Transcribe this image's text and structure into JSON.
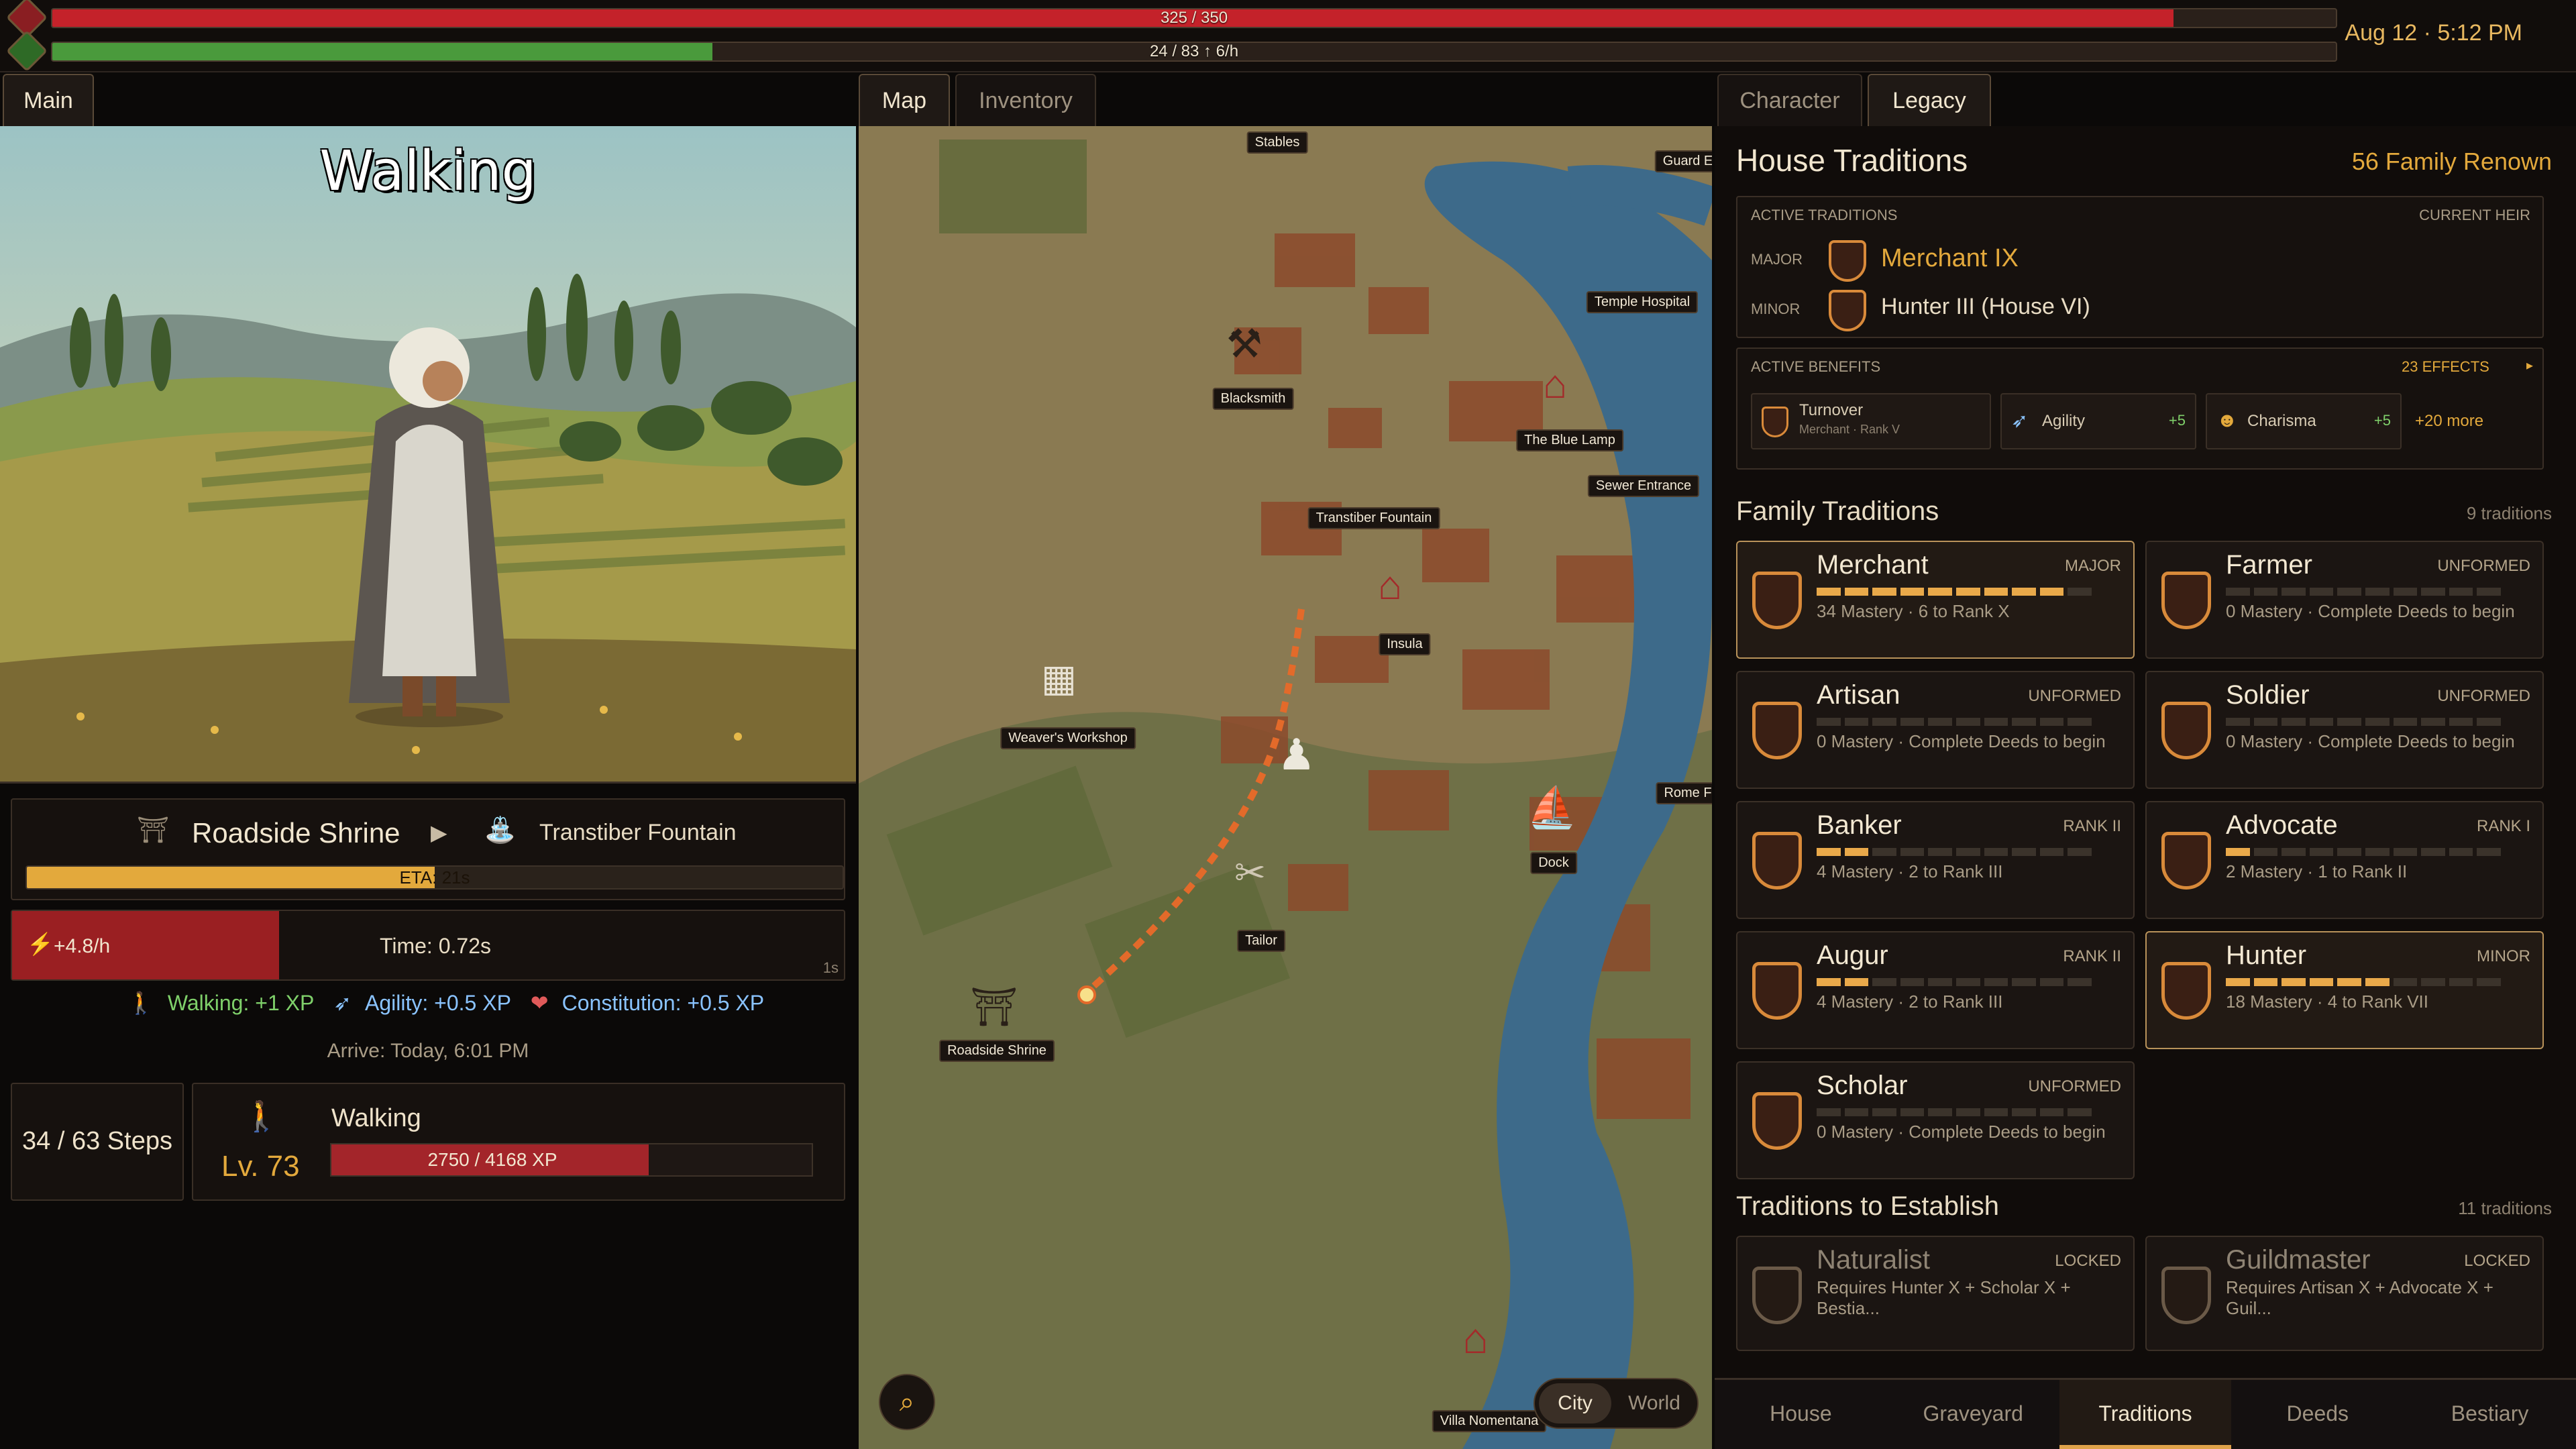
{
  "top": {
    "health_text": "325 / 350",
    "health_pct": 0.929,
    "energy_text": "24 / 83 ↑ 6/h",
    "energy_pct": 0.289,
    "clock": "Aug 12 · 5:12 PM",
    "colors": {
      "health": "#c4222a",
      "energy": "#4a9a3c"
    }
  },
  "left": {
    "tab_main": "Main",
    "scene_title": "Walking",
    "route": {
      "from": "Roadside Shrine",
      "to": "Transtiber Fountain",
      "eta": "ETA: 21s",
      "progress_pct": 0.5
    },
    "rate": "+4.8/h",
    "time": "Time: 0.72s",
    "interval": "1s",
    "xp": {
      "walking": "Walking: +1 XP",
      "agility": "Agility: +0.5 XP",
      "constitution": "Constitution: +0.5 XP"
    },
    "arrive": "Arrive: Today, 6:01 PM",
    "steps": "34 / 63 Steps",
    "skill": {
      "name": "Walking",
      "level": "Lv. 73",
      "xp_text": "2750 / 4168 XP",
      "xp_pct": 0.66
    }
  },
  "map": {
    "tabs": [
      "Map",
      "Inventory"
    ],
    "labels": {
      "stables": "Stables",
      "guard": "Guard E",
      "temple_hospital": "Temple Hospital",
      "blacksmith": "Blacksmith",
      "blue_lamp": "The Blue Lamp",
      "sewer_entrance": "Sewer Entrance",
      "transtiber_fountain": "Transtiber Fountain",
      "insula": "Insula",
      "weavers_workshop": "Weaver's Workshop",
      "rome": "Rome F",
      "dock": "Dock",
      "tailor": "Tailor",
      "roadside_shrine": "Roadside Shrine",
      "villa_nomentana": "Villa Nomentana"
    },
    "toggle": {
      "city": "City",
      "world": "World"
    }
  },
  "right": {
    "tabs": [
      "Character",
      "Legacy"
    ],
    "title": "House Traditions",
    "renown": "56 Family Renown",
    "active_traditions": {
      "heading": "ACTIVE TRADITIONS",
      "current_heir": "CURRENT HEIR",
      "major_label": "MAJOR",
      "major": "Merchant IX",
      "minor_label": "MINOR",
      "minor": "Hunter III (House VI)"
    },
    "active_benefits": {
      "heading": "ACTIVE BENEFITS",
      "effects": "23 EFFECTS",
      "turnover": "Turnover",
      "turnover_sub": "Merchant · Rank V",
      "agility": "Agility",
      "agility_val": "+5",
      "charisma": "Charisma",
      "charisma_val": "+5",
      "more": "+20 more"
    },
    "family": {
      "heading": "Family Traditions",
      "count": "9 traditions",
      "cards": [
        {
          "name": "Merchant",
          "tag": "MAJOR",
          "desc": "34 Mastery · 6 to Rank X",
          "filled": 9
        },
        {
          "name": "Farmer",
          "tag": "UNFORMED",
          "desc": "0 Mastery · Complete Deeds to begin",
          "filled": 0
        },
        {
          "name": "Artisan",
          "tag": "UNFORMED",
          "desc": "0 Mastery · Complete Deeds to begin",
          "filled": 0
        },
        {
          "name": "Soldier",
          "tag": "UNFORMED",
          "desc": "0 Mastery · Complete Deeds to begin",
          "filled": 0
        },
        {
          "name": "Banker",
          "tag": "RANK II",
          "desc": "4 Mastery · 2 to Rank III",
          "filled": 2
        },
        {
          "name": "Advocate",
          "tag": "RANK I",
          "desc": "2 Mastery · 1 to Rank II",
          "filled": 1
        },
        {
          "name": "Augur",
          "tag": "RANK II",
          "desc": "4 Mastery · 2 to Rank III",
          "filled": 2
        },
        {
          "name": "Hunter",
          "tag": "MINOR",
          "desc": "18 Mastery · 4 to Rank VII",
          "filled": 6
        },
        {
          "name": "Scholar",
          "tag": "UNFORMED",
          "desc": "0 Mastery · Complete Deeds to begin",
          "filled": 0
        }
      ]
    },
    "establish": {
      "heading": "Traditions to Establish",
      "count": "11 traditions",
      "cards": [
        {
          "name": "Naturalist",
          "tag": "LOCKED",
          "desc": "Requires Hunter X + Scholar X + Bestia..."
        },
        {
          "name": "Guildmaster",
          "tag": "LOCKED",
          "desc": "Requires Artisan X + Advocate X + Guil..."
        }
      ]
    },
    "bottom_nav": [
      "House",
      "Graveyard",
      "Traditions",
      "Deeds",
      "Bestiary"
    ]
  }
}
